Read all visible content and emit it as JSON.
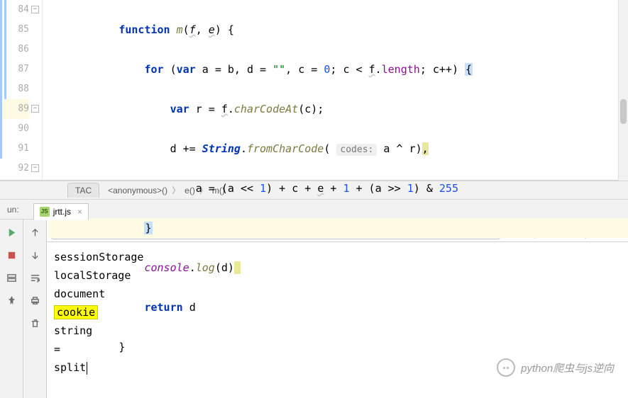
{
  "gutter": {
    "start": 84,
    "end": 92
  },
  "code": {
    "l84": {
      "fn": "function",
      "name": "m",
      "p1": "f",
      "p2": "e",
      "brace": "{"
    },
    "l85": {
      "for": "for",
      "var": "var",
      "a": "a",
      "eq": "=",
      "b": "b",
      "d": "d",
      "empty": "\"\"",
      "c": "c",
      "zero": "0",
      "lt": "<",
      "f": "f",
      "len": "length",
      "inc": "c++",
      "brace": "{"
    },
    "l86": {
      "var": "var",
      "r": "r",
      "eq": "=",
      "f": "f",
      "method": "charCodeAt",
      "c": "c"
    },
    "l87": {
      "d": "d",
      "pluseq": "+=",
      "string": "String",
      "method": "fromCharCode",
      "hint": "codes:",
      "a": "a",
      "xor": "^",
      "r": "r",
      "comma": ","
    },
    "l88": {
      "a": "a",
      "eq": "=",
      "a2": "a",
      "shl": "<<",
      "one": "1",
      "plus": "+",
      "c": "c",
      "e": "e",
      "one2": "1",
      "a3": "a",
      "shr": ">>",
      "one3": "1",
      "amp": "&",
      "mask": "255"
    },
    "l89": {
      "brace": "}"
    },
    "l90": {
      "console": "console",
      "log": "log",
      "d": "d"
    },
    "l91": {
      "return": "return",
      "d": "d"
    },
    "l92": {
      "brace": "}"
    }
  },
  "breadcrumb": {
    "badge": "TAC",
    "i1": "<anonymous>()",
    "i2": "e()",
    "i3": "m()"
  },
  "run": {
    "label": "un:",
    "tab": "jrtt.js"
  },
  "search": {
    "value": "cookie"
  },
  "output": {
    "l1": "sessionStorage",
    "l2": "localStorage",
    "l3": "document",
    "l4": "cookie",
    "l5": "string",
    "l6": "=",
    "l7": "split"
  },
  "watermark": "python爬虫与js逆向"
}
